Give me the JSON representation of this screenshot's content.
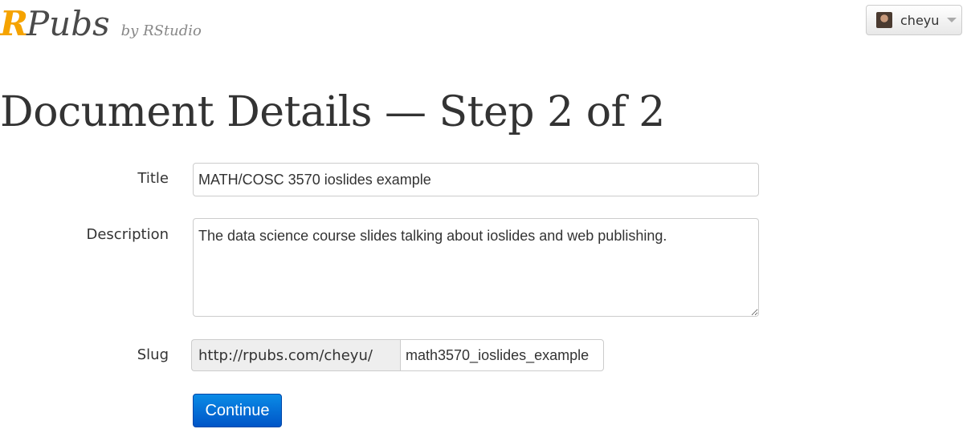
{
  "header": {
    "logo_r": "R",
    "logo_pubs": "Pubs",
    "logo_by": "by RStudio",
    "brand_color": "#f5a300"
  },
  "user_menu": {
    "username": "cheyu",
    "avatar": "user-avatar-photo",
    "caret_icon": "chevron-down-icon"
  },
  "page": {
    "title": "Document Details — Step 2 of 2"
  },
  "form": {
    "title_label": "Title",
    "title_value": "MATH/COSC 3570 ioslides example",
    "description_label": "Description",
    "description_value": "The data science course slides talking about ioslides and web publishing.",
    "slug_label": "Slug",
    "slug_prefix": "http://rpubs.com/cheyu/",
    "slug_value": "math3570_ioslides_example",
    "continue_label": "Continue",
    "continue_color": "#0a74da"
  }
}
